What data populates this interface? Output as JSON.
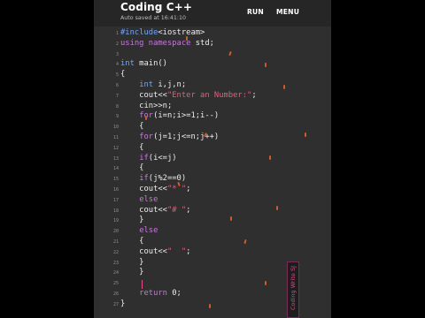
{
  "app": {
    "title": "Coding C++",
    "status": "Auto saved at 16:41:10",
    "actions": {
      "run": "RUN",
      "menu": "MENU"
    }
  },
  "editor": {
    "lines": [
      {
        "n": "1",
        "tokens": [
          {
            "t": "#include",
            "c": "ty"
          },
          {
            "t": "<iostream>",
            "c": ""
          }
        ]
      },
      {
        "n": "2",
        "tokens": [
          {
            "t": "using",
            "c": "kw"
          },
          {
            "t": " ",
            "c": ""
          },
          {
            "t": "namespace",
            "c": "kw"
          },
          {
            "t": " std;",
            "c": ""
          }
        ]
      },
      {
        "n": "3",
        "tokens": []
      },
      {
        "n": "4",
        "tokens": [
          {
            "t": "int",
            "c": "ty"
          },
          {
            "t": " main()",
            "c": ""
          }
        ]
      },
      {
        "n": "5",
        "tokens": [
          {
            "t": "{",
            "c": ""
          }
        ]
      },
      {
        "n": "6",
        "tokens": [
          {
            "t": "    ",
            "c": ""
          },
          {
            "t": "int",
            "c": "ty"
          },
          {
            "t": " i,j,n;",
            "c": ""
          }
        ]
      },
      {
        "n": "7",
        "tokens": [
          {
            "t": "    cout<<",
            "c": ""
          },
          {
            "t": "\"Enter an Number:\"",
            "c": "str"
          },
          {
            "t": ";",
            "c": ""
          }
        ]
      },
      {
        "n": "8",
        "tokens": [
          {
            "t": "    cin>>n;",
            "c": ""
          }
        ]
      },
      {
        "n": "9",
        "tokens": [
          {
            "t": "    ",
            "c": ""
          },
          {
            "t": "for",
            "c": "kw"
          },
          {
            "t": "(i=n;i>=1;i--)",
            "c": ""
          }
        ]
      },
      {
        "n": "10",
        "tokens": [
          {
            "t": "    {",
            "c": ""
          }
        ]
      },
      {
        "n": "11",
        "tokens": [
          {
            "t": "    ",
            "c": ""
          },
          {
            "t": "for",
            "c": "kw"
          },
          {
            "t": "(j=1;j<=n;j++)",
            "c": ""
          }
        ]
      },
      {
        "n": "12",
        "tokens": [
          {
            "t": "    {",
            "c": ""
          }
        ]
      },
      {
        "n": "13",
        "tokens": [
          {
            "t": "    ",
            "c": ""
          },
          {
            "t": "if",
            "c": "kw"
          },
          {
            "t": "(i<=j)",
            "c": ""
          }
        ]
      },
      {
        "n": "14",
        "tokens": [
          {
            "t": "    {",
            "c": ""
          }
        ]
      },
      {
        "n": "15",
        "tokens": [
          {
            "t": "    ",
            "c": ""
          },
          {
            "t": "if",
            "c": "kw"
          },
          {
            "t": "(j%2==0)",
            "c": ""
          }
        ]
      },
      {
        "n": "16",
        "tokens": [
          {
            "t": "    cout<<",
            "c": ""
          },
          {
            "t": "\"* \"",
            "c": "str"
          },
          {
            "t": ";",
            "c": ""
          }
        ]
      },
      {
        "n": "17",
        "tokens": [
          {
            "t": "    ",
            "c": ""
          },
          {
            "t": "else",
            "c": "kw"
          }
        ]
      },
      {
        "n": "18",
        "tokens": [
          {
            "t": "    cout<<",
            "c": ""
          },
          {
            "t": "\"# \"",
            "c": "str"
          },
          {
            "t": ";",
            "c": ""
          }
        ]
      },
      {
        "n": "19",
        "tokens": [
          {
            "t": "    }",
            "c": ""
          }
        ]
      },
      {
        "n": "20",
        "tokens": [
          {
            "t": "    ",
            "c": ""
          },
          {
            "t": "else",
            "c": "kw"
          }
        ]
      },
      {
        "n": "21",
        "tokens": [
          {
            "t": "    {",
            "c": ""
          }
        ]
      },
      {
        "n": "22",
        "tokens": [
          {
            "t": "    cout<<",
            "c": ""
          },
          {
            "t": "\"  \"",
            "c": "str"
          },
          {
            "t": ";",
            "c": ""
          }
        ]
      },
      {
        "n": "23",
        "tokens": [
          {
            "t": "    }",
            "c": ""
          }
        ]
      },
      {
        "n": "24",
        "tokens": [
          {
            "t": "    }",
            "c": ""
          }
        ]
      },
      {
        "n": "25",
        "tokens": []
      },
      {
        "n": "26",
        "tokens": [
          {
            "t": "    ",
            "c": ""
          },
          {
            "t": "return",
            "c": "kw"
          },
          {
            "t": " 0;",
            "c": ""
          }
        ]
      },
      {
        "n": "27",
        "tokens": [
          {
            "t": "}",
            "c": ""
          }
        ]
      }
    ]
  },
  "watermark": {
    "text": "Coding Write SJ"
  },
  "colors": {
    "background": "#000000",
    "screen": "#2f2f2f",
    "appbar": "#262626",
    "keyword": "#c678dd",
    "type": "#6ea7ff",
    "string": "#e0607a",
    "spark": "#d05a2c"
  }
}
